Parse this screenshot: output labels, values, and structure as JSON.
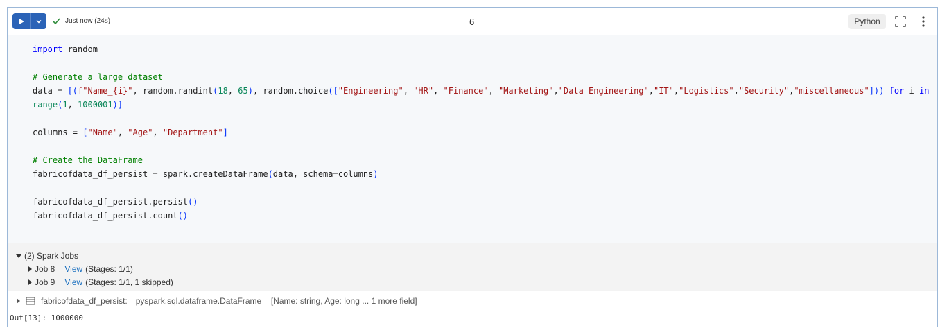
{
  "toolbar": {
    "status": "Just now (24s)",
    "execution_count": "6",
    "language": "Python"
  },
  "code": {
    "lines": [
      [
        {
          "t": "import",
          "c": "kw"
        },
        {
          "t": " random",
          "c": "fn"
        }
      ],
      [],
      [
        {
          "t": "# Generate a large dataset",
          "c": "cmt"
        }
      ],
      [
        {
          "t": "data = ",
          "c": "fn"
        },
        {
          "t": "[(",
          "c": "par"
        },
        {
          "t": "f\"Name_{i}\"",
          "c": "str"
        },
        {
          "t": ", random.randint",
          "c": "fn"
        },
        {
          "t": "(",
          "c": "par"
        },
        {
          "t": "18",
          "c": "num"
        },
        {
          "t": ", ",
          "c": "fn"
        },
        {
          "t": "65",
          "c": "num"
        },
        {
          "t": ")",
          "c": "par"
        },
        {
          "t": ", random.choice",
          "c": "fn"
        },
        {
          "t": "([",
          "c": "par"
        },
        {
          "t": "\"Engineering\"",
          "c": "str"
        },
        {
          "t": ", ",
          "c": "fn"
        },
        {
          "t": "\"HR\"",
          "c": "str"
        },
        {
          "t": ", ",
          "c": "fn"
        },
        {
          "t": "\"Finance\"",
          "c": "str"
        },
        {
          "t": ", ",
          "c": "fn"
        },
        {
          "t": "\"Marketing\"",
          "c": "str"
        },
        {
          "t": ",",
          "c": "fn"
        },
        {
          "t": "\"Data Engineering\"",
          "c": "str"
        },
        {
          "t": ",",
          "c": "fn"
        },
        {
          "t": "\"IT\"",
          "c": "str"
        },
        {
          "t": ",",
          "c": "fn"
        },
        {
          "t": "\"Logistics\"",
          "c": "str"
        },
        {
          "t": ",",
          "c": "fn"
        },
        {
          "t": "\"Security\"",
          "c": "str"
        },
        {
          "t": ",",
          "c": "fn"
        },
        {
          "t": "\"miscellaneous\"",
          "c": "str"
        },
        {
          "t": "]))",
          "c": "par"
        },
        {
          "t": " for",
          "c": "kw"
        },
        {
          "t": " i ",
          "c": "fn"
        },
        {
          "t": "in",
          "c": "kw"
        }
      ],
      [
        {
          "t": "range",
          "c": "num"
        },
        {
          "t": "(",
          "c": "par"
        },
        {
          "t": "1",
          "c": "num"
        },
        {
          "t": ", ",
          "c": "fn"
        },
        {
          "t": "1000001",
          "c": "num"
        },
        {
          "t": ")]",
          "c": "par"
        }
      ],
      [],
      [
        {
          "t": "columns = ",
          "c": "fn"
        },
        {
          "t": "[",
          "c": "par"
        },
        {
          "t": "\"Name\"",
          "c": "str"
        },
        {
          "t": ", ",
          "c": "fn"
        },
        {
          "t": "\"Age\"",
          "c": "str"
        },
        {
          "t": ", ",
          "c": "fn"
        },
        {
          "t": "\"Department\"",
          "c": "str"
        },
        {
          "t": "]",
          "c": "par"
        }
      ],
      [],
      [
        {
          "t": "# Create the DataFrame",
          "c": "cmt"
        }
      ],
      [
        {
          "t": "fabricofdata_df_persist = spark.createDataFrame",
          "c": "fn"
        },
        {
          "t": "(",
          "c": "par"
        },
        {
          "t": "data, schema=columns",
          "c": "fn"
        },
        {
          "t": ")",
          "c": "par"
        }
      ],
      [],
      [
        {
          "t": "fabricofdata_df_persist.persist",
          "c": "fn"
        },
        {
          "t": "()",
          "c": "par"
        }
      ],
      [
        {
          "t": "fabricofdata_df_persist.count",
          "c": "fn"
        },
        {
          "t": "()",
          "c": "par"
        }
      ]
    ]
  },
  "spark_jobs": {
    "header": "(2) Spark Jobs",
    "jobs": [
      {
        "name": "Job 8",
        "link": "View",
        "detail": "(Stages: 1/1)"
      },
      {
        "name": "Job 9",
        "link": "View",
        "detail": "(Stages: 1/1, 1 skipped)"
      }
    ]
  },
  "dataframe": {
    "name": "fabricofdata_df_persist:",
    "type": "pyspark.sql.dataframe.DataFrame = [Name: string, Age: long ... 1 more field]"
  },
  "output": "Out[13]: 1000000",
  "colors": {
    "accent": "#2b63b7",
    "success": "#2e8b3a",
    "link": "#1a6fbf"
  }
}
